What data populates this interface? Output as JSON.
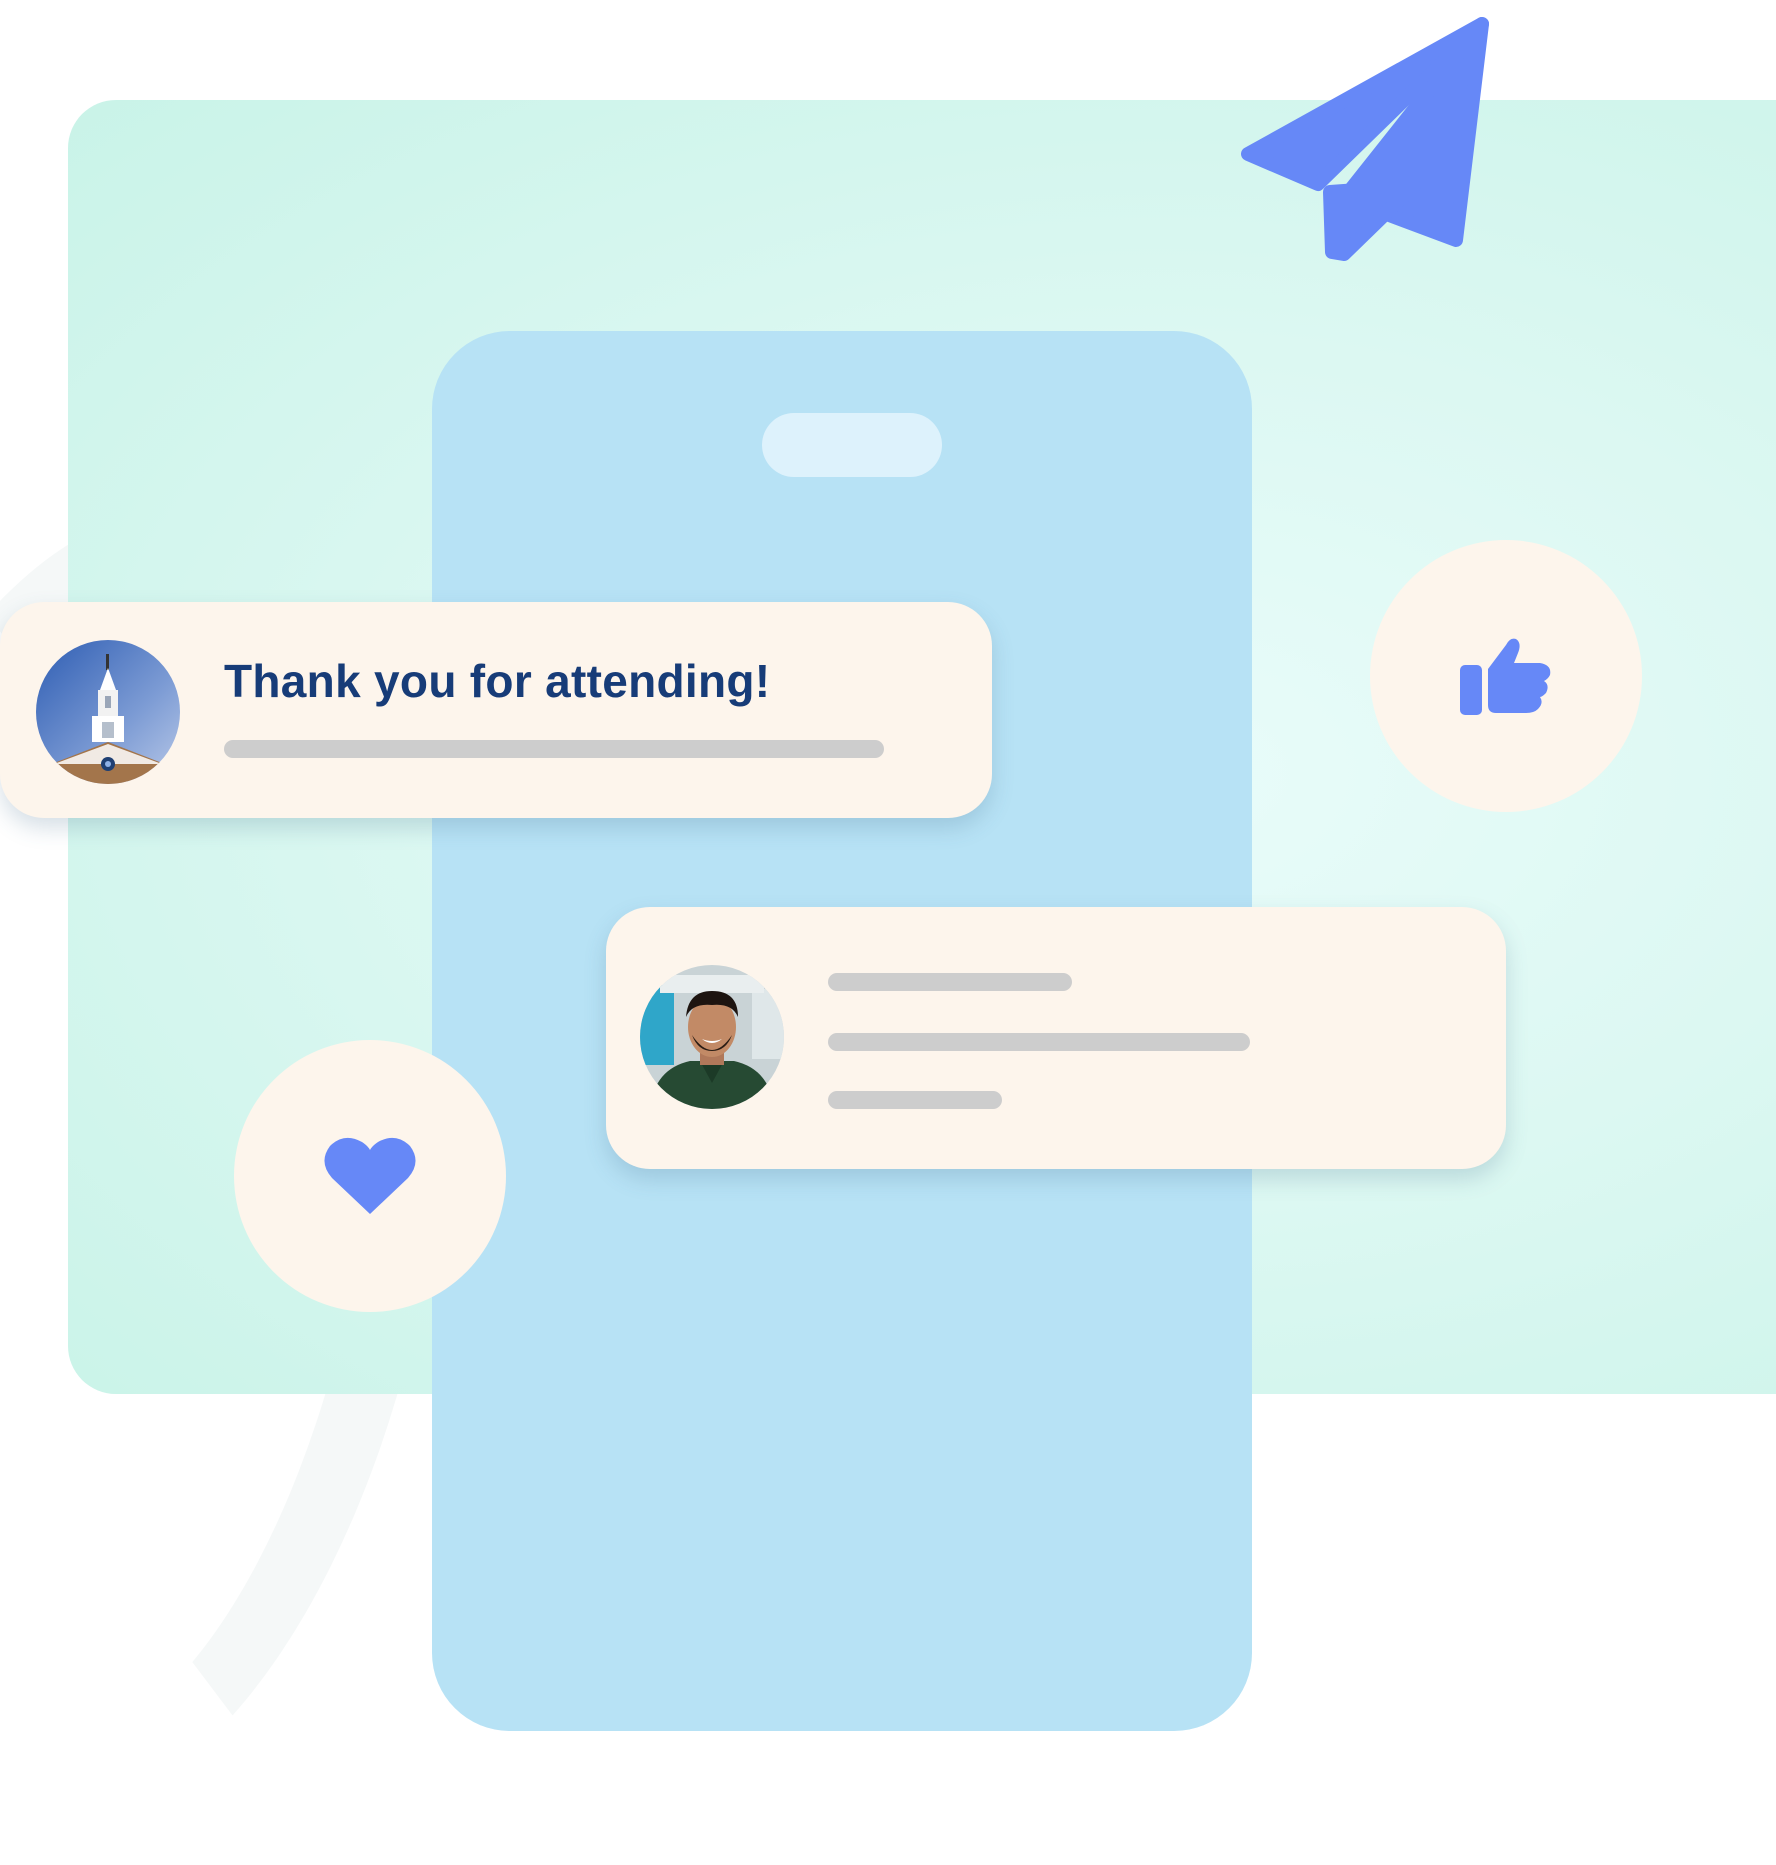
{
  "message": {
    "title": "Thank you for attending!"
  },
  "icons": {
    "send": "paper-plane-icon",
    "like": "thumbs-up-icon",
    "heart": "heart-icon",
    "avatar_1": "building-steeple-avatar",
    "avatar_2": "person-avatar"
  },
  "colors": {
    "accent": "#6688f7",
    "title_text": "#173c78",
    "bubble": "#fdf5ec",
    "phone": "#b7e2f5",
    "backdrop": "#d6f7ef",
    "placeholder_line": "#cdcdcd"
  }
}
